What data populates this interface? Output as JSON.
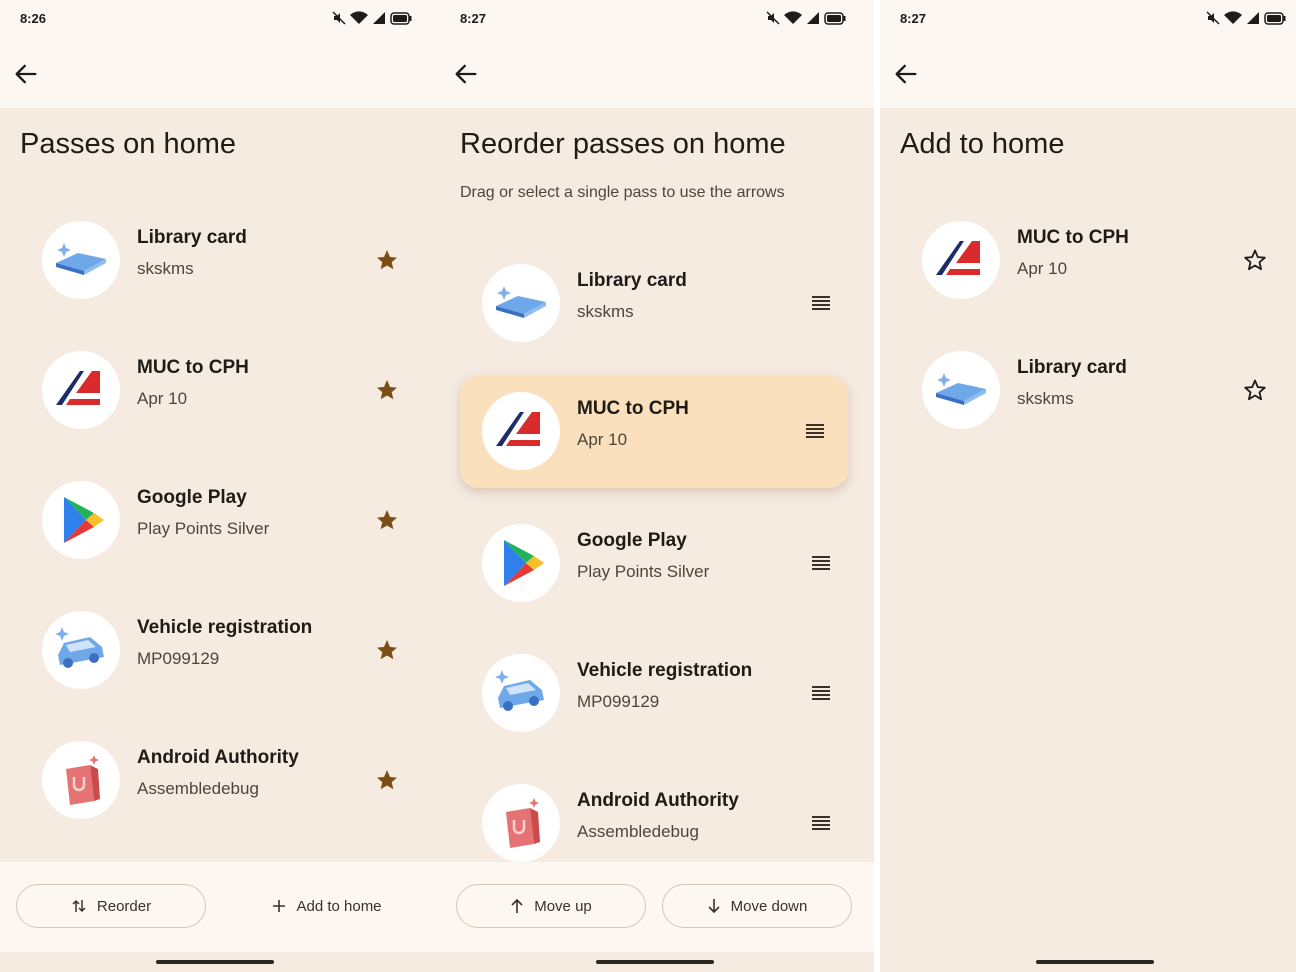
{
  "panels": [
    {
      "status_time": "8:26",
      "title": "Passes on home",
      "items": [
        {
          "name": "Library card",
          "sub": "skskms",
          "icon": "library-book-icon"
        },
        {
          "name": "MUC to CPH",
          "sub": "Apr 10",
          "icon": "airline-logo-icon"
        },
        {
          "name": "Google Play",
          "sub": "Play Points Silver",
          "icon": "google-play-icon"
        },
        {
          "name": "Vehicle registration",
          "sub": "MP099129",
          "icon": "car-icon"
        },
        {
          "name": "Android Authority",
          "sub": "Assembledebug",
          "icon": "shopping-bag-icon"
        }
      ],
      "trailing_icon": "star-filled-icon",
      "buttons": {
        "reorder": "Reorder",
        "add_to_home": "Add to home"
      }
    },
    {
      "status_time": "8:27",
      "title": "Reorder passes on home",
      "subtitle": "Drag or select a single pass to use the arrows",
      "items": [
        {
          "name": "Library card",
          "sub": "skskms",
          "icon": "library-book-icon"
        },
        {
          "name": "MUC to CPH",
          "sub": "Apr 10",
          "icon": "airline-logo-icon",
          "selected": true
        },
        {
          "name": "Google Play",
          "sub": "Play Points Silver",
          "icon": "google-play-icon"
        },
        {
          "name": "Vehicle registration",
          "sub": "MP099129",
          "icon": "car-icon"
        },
        {
          "name": "Android Authority",
          "sub": "Assembledebug",
          "icon": "shopping-bag-icon"
        }
      ],
      "trailing_icon": "drag-handle-icon",
      "buttons": {
        "move_up": "Move up",
        "move_down": "Move down"
      }
    },
    {
      "status_time": "8:27",
      "title": "Add to home",
      "items": [
        {
          "name": "MUC to CPH",
          "sub": "Apr 10",
          "icon": "airline-logo-icon"
        },
        {
          "name": "Library card",
          "sub": "skskms",
          "icon": "library-book-icon"
        }
      ],
      "trailing_icon": "star-outline-icon"
    }
  ],
  "colors": {
    "background": "#f6ebe1",
    "bar_background": "#fdf7f2",
    "selected_item": "#fbe0bd",
    "star": "#7a4e14",
    "text_primary": "#1f1b16",
    "text_secondary": "#4f4539"
  }
}
